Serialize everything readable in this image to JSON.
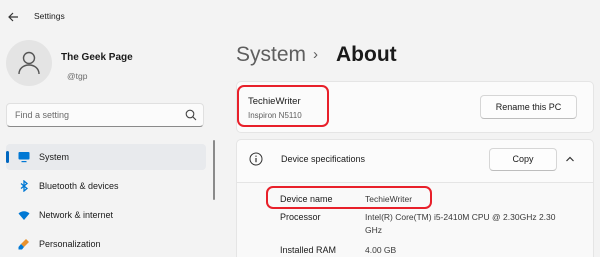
{
  "window": {
    "title": "Settings"
  },
  "profile": {
    "name": "The Geek Page",
    "handle": "@tgp"
  },
  "search": {
    "placeholder": "Find a setting"
  },
  "sidebar": {
    "items": [
      {
        "label": "System",
        "icon": "monitor-icon",
        "active": true
      },
      {
        "label": "Bluetooth & devices",
        "icon": "bluetooth-icon",
        "active": false
      },
      {
        "label": "Network & internet",
        "icon": "wifi-icon",
        "active": false
      },
      {
        "label": "Personalization",
        "icon": "brush-icon",
        "active": false
      }
    ]
  },
  "breadcrumb": {
    "parent": "System",
    "separator": "›",
    "current": "About"
  },
  "pc_card": {
    "name": "TechieWriter",
    "model": "Inspiron N5110",
    "rename_label": "Rename this PC"
  },
  "specs": {
    "title": "Device specifications",
    "copy_label": "Copy",
    "rows": [
      {
        "label": "Device name",
        "value": "TechieWriter"
      },
      {
        "label": "Processor",
        "value": "Intel(R) Core(TM) i5-2410M CPU @ 2.30GHz   2.30 GHz"
      },
      {
        "label": "Installed RAM",
        "value": "4.00 GB"
      }
    ]
  },
  "colors": {
    "accent": "#0067c0",
    "highlight": "#e8202a",
    "background": "#f3f3f3"
  }
}
